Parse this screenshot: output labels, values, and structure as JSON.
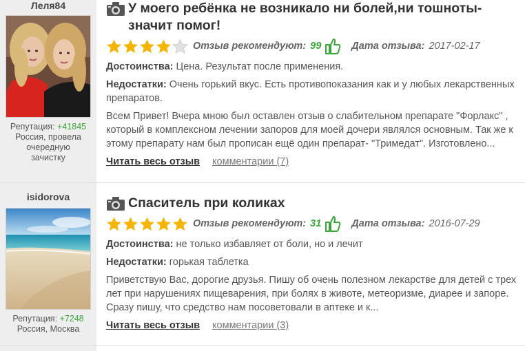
{
  "colors": {
    "accent_green": "#3aa63a",
    "star": "#f5b400",
    "star_empty": "#cccccc"
  },
  "reviews": [
    {
      "user": {
        "name": "Леля84",
        "reputation_label": "Репутация:",
        "reputation_value": "+41845",
        "location": "Россия, провела очередную зачистку",
        "avatar": "photo-two-women-icon"
      },
      "title": "У моего ребёнка не возникало ни болей,ни тошноты-значит помог!",
      "rating": 4,
      "rec_label": "Отзыв рекомендуют:",
      "rec_value": "99",
      "date_label": "Дата отзыва:",
      "date_value": "2017-02-17",
      "pros_label": "Достоинства:",
      "pros": "Цена. Результат после применения.",
      "cons_label": "Недостатки:",
      "cons": "Очень горький вкус. Есть противопоказания как и у любых лекарственных препаратов.",
      "text": "Всем Привет! Вчера мною был оставлен отзыв о слабительном препарате \"Форлакс\" , который в комплексном лечении запоров для моей дочери являлся основным. Так же к этому препарату нам был прописан ещё один препарат- \"Тримедат\". Изготовлено...",
      "read_label": "Читать весь отзыв",
      "comments_label": "комментарии (7)"
    },
    {
      "user": {
        "name": "isidorova",
        "reputation_label": "Репутация:",
        "reputation_value": "+7248",
        "location": "Россия, Москва",
        "avatar": "photo-beach-icon"
      },
      "title": "Спаситель при коликах",
      "rating": 5,
      "rec_label": "Отзыв рекомендуют:",
      "rec_value": "31",
      "date_label": "Дата отзыва:",
      "date_value": "2016-07-29",
      "pros_label": "Достоинства:",
      "pros": "не только избавляет от боли, но и лечит",
      "cons_label": "Недостатки:",
      "cons": "горькая таблетка",
      "text": "Приветствую Вас, дорогие друзья. Пишу об очень полезном лекарстве для детей с трех лет при нарушениях пищеварения, при болях в животе, метеоризме, диарее и запоре. Сразу пишу, что средство нам посоветовали в аптеке и к...",
      "read_label": "Читать весь отзыв",
      "comments_label": "комментарии (3)"
    }
  ]
}
